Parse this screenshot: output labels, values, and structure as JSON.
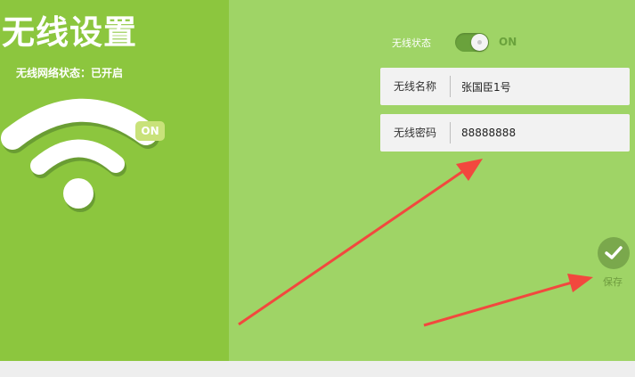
{
  "title": "无线设置",
  "status": "无线网络状态：已开启",
  "wifi_badge": "ON",
  "toggle": {
    "label": "无线状态",
    "state_text": "ON"
  },
  "fields": [
    {
      "label": "无线名称",
      "value": "张国臣1号"
    },
    {
      "label": "无线密码",
      "value": "88888888"
    }
  ],
  "save_label": "保存",
  "colors": {
    "left_panel": "#8cc63e",
    "right_panel": "#9fd466",
    "arrow": "#f2483e",
    "save_button": "#7aa84c"
  }
}
